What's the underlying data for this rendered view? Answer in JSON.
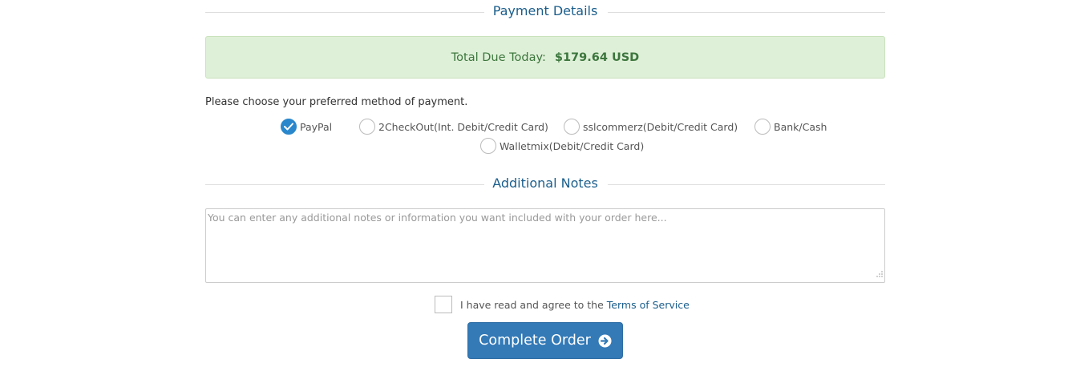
{
  "payment_section": {
    "title": "Payment Details",
    "total_label": "Total Due Today:",
    "total_amount": "$179.64 USD",
    "choose_label": "Please choose your preferred method of payment.",
    "methods": [
      {
        "label": "PayPal",
        "selected": true
      },
      {
        "label": "2CheckOut(Int. Debit/Credit Card)",
        "selected": false
      },
      {
        "label": "sslcommerz(Debit/Credit Card)",
        "selected": false
      },
      {
        "label": "Bank/Cash",
        "selected": false
      },
      {
        "label": "Walletmix(Debit/Credit Card)",
        "selected": false
      }
    ]
  },
  "notes_section": {
    "title": "Additional Notes",
    "placeholder": "You can enter any additional notes or information you want included with your order here..."
  },
  "terms": {
    "text": "I have read and agree to the",
    "link": "Terms of Service",
    "checked": false
  },
  "complete_button": {
    "label": "Complete Order",
    "icon": "arrow-circle-right-icon"
  },
  "colors": {
    "heading": "#1b5e8c",
    "success_bg": "#dff0d8",
    "success_text": "#3c763d",
    "primary": "#337ab7",
    "radio_checked": "#2a87cc"
  }
}
